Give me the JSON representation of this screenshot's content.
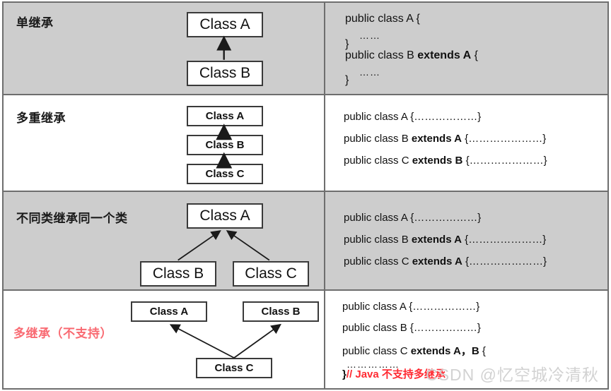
{
  "rows": [
    {
      "title": "单继承",
      "shaded": true,
      "diagram": {
        "boxes": [
          {
            "label": "Class A"
          },
          {
            "label": "Class B"
          }
        ]
      },
      "code": {
        "line1": "public class A {",
        "line2": "……",
        "line3": "}",
        "line4_pre": "public class B ",
        "line4_kw": "extends A",
        "line4_post": " {",
        "line5": "……",
        "line6": "}"
      }
    },
    {
      "title": "多重继承",
      "shaded": false,
      "diagram": {
        "boxes": [
          {
            "label": "Class A"
          },
          {
            "label": "Class B"
          },
          {
            "label": "Class C"
          }
        ]
      },
      "code": {
        "line1": "public class A {………………}",
        "line2_pre": "public class B ",
        "line2_kw": "extends A",
        "line2_post": " {…………………}",
        "line3_pre": "public class C ",
        "line3_kw": "extends B",
        "line3_post": " {…………………}"
      }
    },
    {
      "title": "不同类继承同一个类",
      "shaded": true,
      "diagram": {
        "boxes": [
          {
            "label": "Class A"
          },
          {
            "label": "Class B"
          },
          {
            "label": "Class C"
          }
        ]
      },
      "code": {
        "line1": "public class A {………………}",
        "line2_pre": "public class B ",
        "line2_kw": "extends A",
        "line2_post": " {…………………}",
        "line3_pre": "public class C ",
        "line3_kw": "extends A",
        "line3_post": " {…………………}"
      }
    },
    {
      "title": "多继承（不支持）",
      "shaded": false,
      "diagram": {
        "boxes": [
          {
            "label": "Class A"
          },
          {
            "label": "Class B"
          },
          {
            "label": "Class C"
          }
        ]
      },
      "code": {
        "line1": "public class A {………………}",
        "line2": "public class B {………………}",
        "line3_pre": "public class C ",
        "line3_kw": "extends A，B",
        "line3_post": " {",
        "line4": "……………",
        "line5_brace": "}",
        "line5_comment": "// Java 不支持多继承"
      }
    }
  ],
  "watermark": "CSDN @忆空城冷清秋",
  "colors": {
    "shaded_bg": "#cdcdcd",
    "plain_bg": "#ffffff",
    "border": "#6e6e6e",
    "box_border": "#3a3a3a",
    "red_title": "#f96a72",
    "red_comment": "#ff2a32",
    "watermark": "#d2d2d2"
  }
}
